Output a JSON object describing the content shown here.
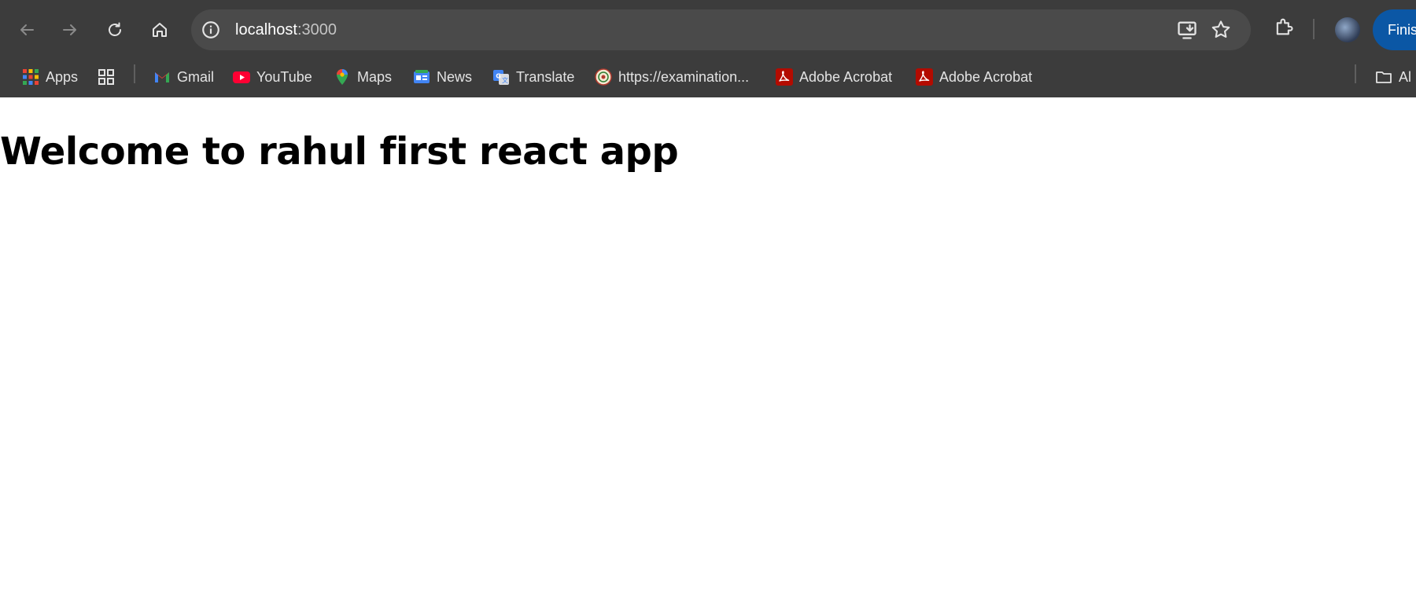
{
  "browser": {
    "url_host": "localhost",
    "url_rest": ":3000",
    "finish_label": "Finish"
  },
  "bookmarks": [
    {
      "label": "Apps",
      "icon": "apps-grid-icon"
    },
    {
      "label": "",
      "icon": "tab-groups-icon"
    },
    {
      "label": "Gmail",
      "icon": "gmail-icon"
    },
    {
      "label": "YouTube",
      "icon": "youtube-icon"
    },
    {
      "label": "Maps",
      "icon": "maps-icon"
    },
    {
      "label": "News",
      "icon": "news-icon"
    },
    {
      "label": "Translate",
      "icon": "translate-icon"
    },
    {
      "label": "https://examination...",
      "icon": "seal-icon"
    },
    {
      "label": "Adobe Acrobat",
      "icon": "adobe-acrobat-icon"
    },
    {
      "label": "Adobe Acrobat",
      "icon": "adobe-acrobat-icon"
    },
    {
      "label": "Al",
      "icon": "folder-icon"
    }
  ],
  "page": {
    "heading": "Welcome to rahul first react app"
  },
  "colors": {
    "chrome_bg": "#3c3c3c",
    "omnibox_bg": "#4a4a4a",
    "accent_button": "#0b57a5",
    "page_bg": "#ffffff"
  }
}
